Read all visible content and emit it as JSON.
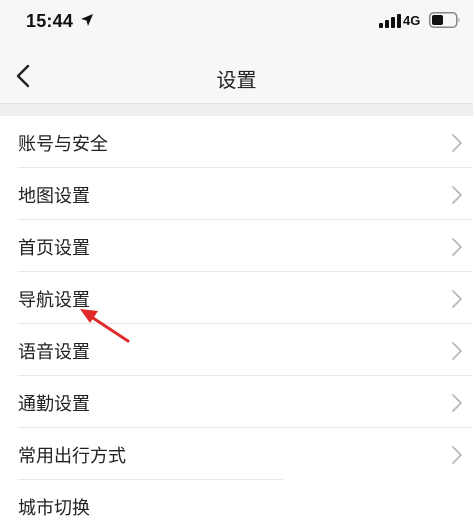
{
  "status_bar": {
    "time": "15:44",
    "network": "4G",
    "location_icon": "location-arrow-icon",
    "signal_icon": "signal-icon",
    "battery_icon": "battery-icon"
  },
  "nav": {
    "title": "设置",
    "back_icon": "chevron-left-icon"
  },
  "items": [
    {
      "label": "账号与安全"
    },
    {
      "label": "地图设置"
    },
    {
      "label": "首页设置"
    },
    {
      "label": "导航设置"
    },
    {
      "label": "语音设置"
    },
    {
      "label": "通勤设置"
    },
    {
      "label": "常用出行方式"
    },
    {
      "label": "城市切换"
    }
  ],
  "annotation": {
    "color": "#e02a2a",
    "icon": "red-arrow-annotation"
  }
}
